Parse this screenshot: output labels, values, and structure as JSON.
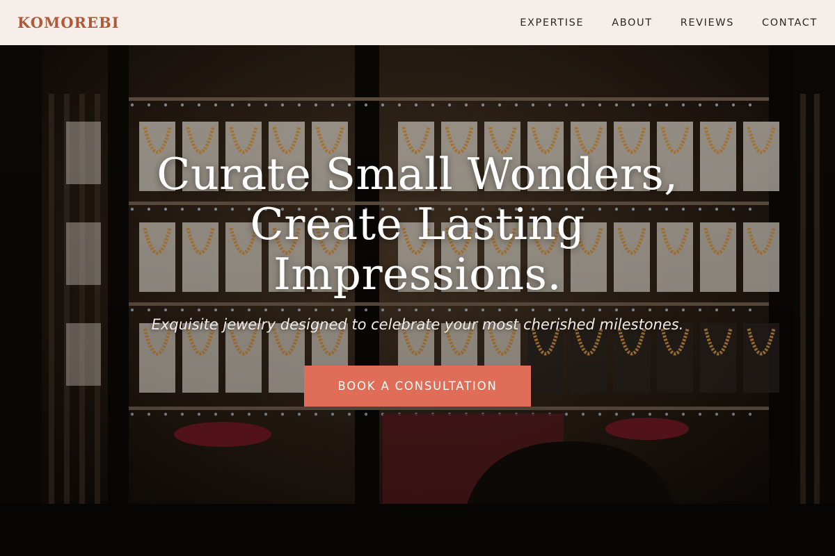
{
  "header": {
    "logo": "KOMOREBI",
    "nav": [
      {
        "label": "EXPERTISE"
      },
      {
        "label": "ABOUT"
      },
      {
        "label": "REVIEWS"
      },
      {
        "label": "CONTACT"
      }
    ]
  },
  "hero": {
    "headline_lines": [
      "Curate Small Wonders,",
      "Create Lasting",
      "Impressions."
    ],
    "subheadline": "Exquisite jewelry designed to celebrate your most cherished milestones.",
    "cta_label": "BOOK A CONSULTATION",
    "background_image": "jewelry-shop-window-at-night"
  },
  "colors": {
    "header_bg": "#f6efe9",
    "logo": "#b0583a",
    "nav_text": "#2d2520",
    "cta_bg": "#e06d57",
    "headline": "#ffffff"
  }
}
